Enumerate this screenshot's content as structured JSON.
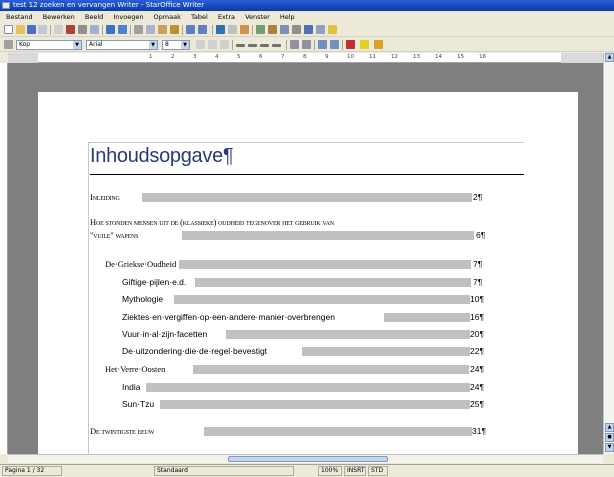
{
  "window": {
    "title": "test 12 zoeken en vervangen Writer - StarOffice Writer"
  },
  "menu": [
    "Bestand",
    "Bewerken",
    "Beeld",
    "Invoegen",
    "Opmaak",
    "Tabel",
    "Extra",
    "Venster",
    "Help"
  ],
  "format_bar": {
    "style_value": "Kop",
    "font_value": "Arial",
    "size_value": "8"
  },
  "ruler": {
    "ticks": [
      "1",
      "2",
      "3",
      "4",
      "5",
      "6",
      "7",
      "8",
      "9",
      "10",
      "11",
      "12",
      "13",
      "14",
      "15",
      "16"
    ]
  },
  "document": {
    "toc_title": "Inhoudsopgave¶",
    "entries": [
      {
        "text": "Inleiding",
        "page": "2¶",
        "level": 1
      },
      {
        "text": "Hoe stonden mensen uit de (klassieke) oudheid tegenover het gebruik van",
        "page": "",
        "level": 1
      },
      {
        "text": "\"vuile\" wapens",
        "page": "6¶",
        "level": 1
      },
      {
        "text": "De·Griekse·Oudheid",
        "page": "7¶",
        "level": 2
      },
      {
        "text": "Giftige·pijlen·e.d.",
        "page": "7¶",
        "level": 3
      },
      {
        "text": "Mythologie",
        "page": "10¶",
        "level": 3
      },
      {
        "text": "Ziektes·en·vergiffen·op·een·andere·manier·overbrengen",
        "page": "16¶",
        "level": 3
      },
      {
        "text": "Vuur·in·al·zijn·facetten",
        "page": "20¶",
        "level": 3
      },
      {
        "text": "De·uitzondering·die·de·regel·bevestigt",
        "page": "22¶",
        "level": 3
      },
      {
        "text": "Het·Verre·Oosten",
        "page": "24¶",
        "level": 2
      },
      {
        "text": "India",
        "page": "24¶",
        "level": 3
      },
      {
        "text": "Sun·Tzu",
        "page": "25¶",
        "level": 3
      },
      {
        "text": "De twintigste eeuw",
        "page": "31¶",
        "level": 1
      }
    ]
  },
  "statusbar": {
    "page_info": "Pagina 1 / 32",
    "style": "Standaard",
    "zoom": "100%",
    "mode": "INSRT",
    "std": "STD"
  },
  "colors": {
    "title_bar": "#0a3aa8",
    "toc_title": "#2a3a7a",
    "field_shading": "#c0c0c0",
    "workspace": "#7f7f7f"
  }
}
